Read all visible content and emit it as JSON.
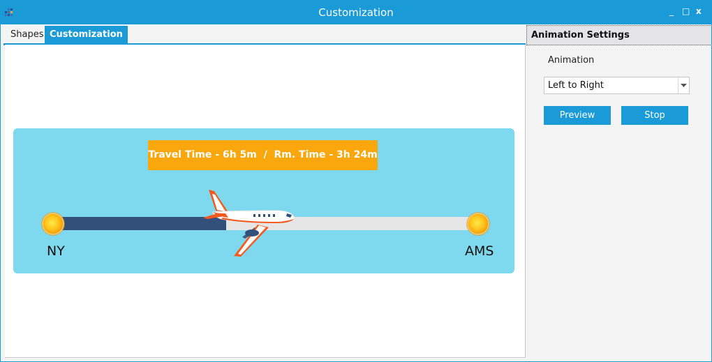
{
  "window": {
    "title": "Customization",
    "controls": {
      "minimize": "_",
      "maximize": "□",
      "close": "x"
    },
    "accent_color": "#1a9ad6"
  },
  "tabs": [
    {
      "label": "Shapes",
      "active": false
    },
    {
      "label": "Customization",
      "active": true
    }
  ],
  "flight": {
    "label": "Travel Time - 6h 5m  /  Rm. Time - 3h 24m",
    "origin": "NY",
    "destination": "AMS",
    "progress_fraction": 0.41,
    "colors": {
      "panel": "#7fd9ee",
      "label": "#f9a70d",
      "track_done": "#33507a",
      "track_remaining": "#e6e6e6"
    }
  },
  "settings": {
    "header": "Animation Settings",
    "animation_label": "Animation",
    "animation_value": "Left to Right",
    "preview_label": "Preview",
    "stop_label": "Stop"
  },
  "icons": {
    "app": "grid-app-icon",
    "plane": "airplane-icon",
    "dropdown": "chevron-down-icon"
  }
}
